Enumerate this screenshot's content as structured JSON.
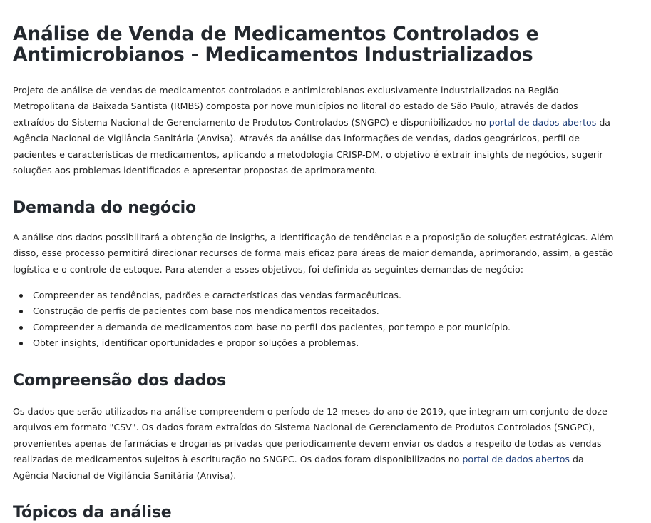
{
  "title": "Análise de Venda de Medicamentos Controlados e Antimicrobianos - Medicamentos Industrializados",
  "intro": {
    "part1": "Projeto de análise de vendas de medicamentos controlados e antimicrobianos exclusivamente industrializados na Região Metropolitana da Baixada Santista (RMBS) composta por nove municípios no litoral do estado de São Paulo, através de dados extraídos do Sistema Nacional de Gerenciamento de Produtos Controlados (SNGPC) e disponibilizados no ",
    "link": "portal de dados abertos",
    "part2": " da Agência Nacional de Vigilância Sanitária (Anvisa). Através da análise das informações de vendas, dados geográricos, perfil de pacientes e características de medicamentos, aplicando a metodologia CRISP-DM, o objetivo é extrair insights de negócios, sugerir soluções aos problemas identificados e apresentar propostas de aprimoramento."
  },
  "demanda": {
    "heading": "Demanda do negócio",
    "paragraph": "A análise dos dados possibilitará a obtenção de insigths, a identificação de tendências e a proposição de soluções estratégicas. Além disso, esse processo permitirá direcionar recursos de forma mais eficaz para áreas de maior demanda, aprimorando, assim, a gestão logística e o controle de estoque. Para atender a esses objetivos, foi definida as seguintes demandas de negócio:",
    "items": [
      "Compreender as tendências, padrões e características das vendas farmacêuticas.",
      "Construção de perfis de pacientes com base nos mendicamentos receitados.",
      "Compreender a demanda de medicamentos com base no perfil dos pacientes, por tempo e por município.",
      "Obter insights, identificar oportunidades e propor soluções a problemas."
    ]
  },
  "compreensao": {
    "heading": "Compreensão dos dados",
    "part1": "Os dados que serão utilizados na análise compreendem o período de 12 meses do ano de 2019, que integram um conjunto de doze arquivos em formato \"CSV\". Os dados foram extraídos do Sistema Nacional de Gerenciamento de Produtos Controlados (SNGPC), provenientes apenas de farmácias e drogarias privadas que periodicamente devem enviar os dados a respeito de todas as vendas realizadas de medicamentos sujeitos à escrituração no SNGPC. Os dados foram disponibilizados no ",
    "link": "portal de dados abertos",
    "part2": " da Agência Nacional de Vigilância Sanitária (Anvisa)."
  },
  "topicos": {
    "heading": "Tópicos da análise"
  },
  "colors": {
    "link": "#1f3f7a",
    "text": "#1f1f1f",
    "heading": "#24292f"
  }
}
